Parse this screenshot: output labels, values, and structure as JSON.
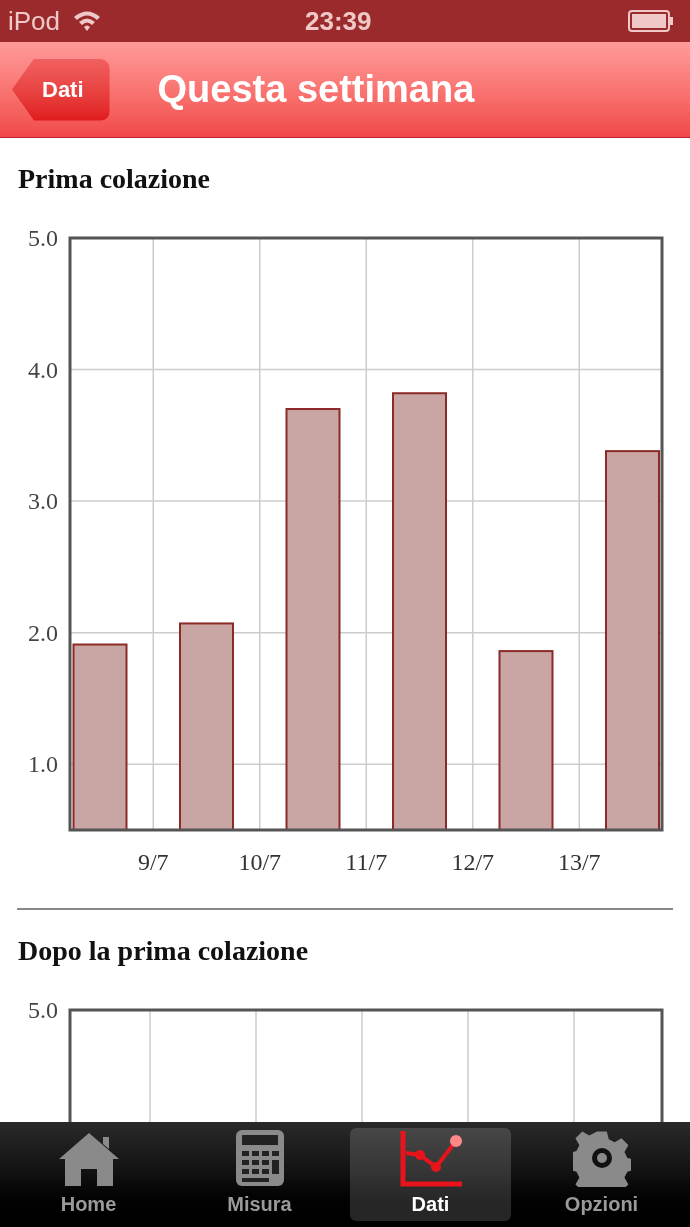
{
  "status_bar": {
    "carrier": "iPod",
    "time": "23:39"
  },
  "nav_bar": {
    "back_button": "Dati",
    "title": "Questa settimana"
  },
  "sections": [
    {
      "title": "Prima colazione",
      "chart_data": {
        "type": "bar",
        "categories": [
          null,
          "9/7",
          "10/7",
          "11/7",
          "12/7",
          "13/7"
        ],
        "values": [
          1.91,
          2.07,
          3.7,
          3.82,
          1.86,
          3.38
        ],
        "ylim": [
          0.5,
          5
        ],
        "grid": true,
        "yticks": [
          {
            "value": 1,
            "label": "1.0"
          },
          {
            "value": 2,
            "label": "2.0"
          },
          {
            "value": 3,
            "label": "3.0"
          },
          {
            "value": 4,
            "label": "4.0"
          },
          {
            "value": 5,
            "label": "5.0"
          }
        ]
      }
    },
    {
      "title": "Dopo la prima colazione",
      "top_tick": "5.0"
    }
  ],
  "tab_bar": [
    {
      "kind": "home",
      "label": "Home",
      "selected": false
    },
    {
      "kind": "calculator",
      "label": "Misura",
      "selected": false
    },
    {
      "kind": "chart",
      "label": "Dati",
      "selected": true
    },
    {
      "kind": "gear",
      "label": "Opzioni",
      "selected": false
    }
  ]
}
